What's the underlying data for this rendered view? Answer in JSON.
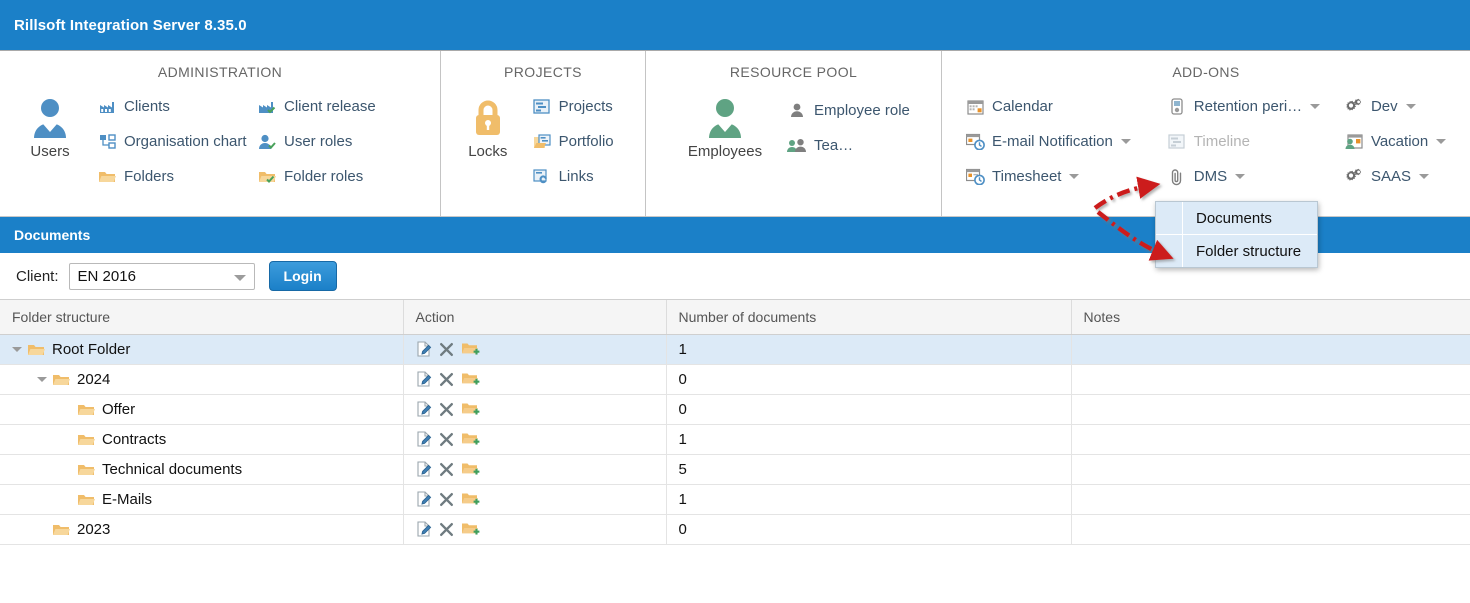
{
  "window": {
    "title": "Rillsoft Integration Server 8.35.0"
  },
  "ribbon": {
    "groups": [
      {
        "title": "ADMINISTRATION",
        "launcher": {
          "label": "Users",
          "icon": "user-icon"
        },
        "col1": [
          {
            "label": "Clients",
            "icon": "factory-icon"
          },
          {
            "label": "Organisation chart",
            "icon": "org-chart-icon"
          },
          {
            "label": "Folders",
            "icon": "folder-icon"
          }
        ],
        "col2": [
          {
            "label": "Client release",
            "icon": "factory-check-icon"
          },
          {
            "label": "User roles",
            "icon": "user-check-icon"
          },
          {
            "label": "Folder roles",
            "icon": "folder-check-icon"
          }
        ]
      },
      {
        "title": "PROJECTS",
        "launcher": {
          "label": "Locks",
          "icon": "lock-icon"
        },
        "col1": [
          {
            "label": "Projects",
            "icon": "project-icon"
          },
          {
            "label": "Portfolio",
            "icon": "portfolio-icon"
          },
          {
            "label": "Links",
            "icon": "links-icon"
          }
        ]
      },
      {
        "title": "RESOURCE POOL",
        "launcher": {
          "label": "Employees",
          "icon": "employee-icon"
        },
        "col1": [
          {
            "label": "Employee role",
            "icon": "person-icon"
          },
          {
            "label": "Tea…",
            "icon": "team-icon"
          }
        ]
      },
      {
        "title": "ADD-ONS",
        "col1": [
          {
            "label": "Calendar",
            "icon": "calendar-icon",
            "caret": false
          },
          {
            "label": "E-mail Notification",
            "icon": "email-clock-icon",
            "caret": true
          },
          {
            "label": "Timesheet",
            "icon": "timesheet-clock-icon",
            "caret": true
          }
        ],
        "col2": [
          {
            "label": "Retention peri…",
            "icon": "retention-icon",
            "caret": true
          },
          {
            "label": "Timeline",
            "icon": "timeline-icon",
            "caret": false,
            "disabled": true
          },
          {
            "label": "DMS",
            "icon": "paperclip-icon",
            "caret": true
          }
        ],
        "col3": [
          {
            "label": "Dev",
            "icon": "gears-icon",
            "caret": true
          },
          {
            "label": "Vacation",
            "icon": "vacation-icon",
            "caret": true
          },
          {
            "label": "SAAS",
            "icon": "gears-icon",
            "caret": true
          }
        ]
      }
    ]
  },
  "dms_menu": {
    "items": [
      {
        "label": "Documents"
      },
      {
        "label": "Folder structure"
      }
    ]
  },
  "page": {
    "header": "Documents",
    "client_label": "Client:",
    "client_value": "EN 2016",
    "login_label": "Login"
  },
  "table": {
    "columns": [
      "Folder structure",
      "Action",
      "Number of documents",
      "Notes"
    ],
    "rows": [
      {
        "name": "Root Folder",
        "indent": 0,
        "expandable": true,
        "documents": "1",
        "notes": "",
        "selected": true
      },
      {
        "name": "2024",
        "indent": 1,
        "expandable": true,
        "documents": "0",
        "notes": "",
        "selected": false
      },
      {
        "name": "Offer",
        "indent": 2,
        "expandable": false,
        "documents": "0",
        "notes": "",
        "selected": false
      },
      {
        "name": "Contracts",
        "indent": 2,
        "expandable": false,
        "documents": "1",
        "notes": "",
        "selected": false
      },
      {
        "name": "Technical documents",
        "indent": 2,
        "expandable": false,
        "documents": "5",
        "notes": "",
        "selected": false
      },
      {
        "name": "E-Mails",
        "indent": 2,
        "expandable": false,
        "documents": "1",
        "notes": "",
        "selected": false
      },
      {
        "name": "2023",
        "indent": 1,
        "expandable": false,
        "documents": "0",
        "notes": "",
        "selected": false
      }
    ],
    "action_icons": [
      "edit-icon",
      "delete-icon",
      "add-folder-icon"
    ]
  },
  "colors": {
    "brand_blue": "#1b80c8",
    "selection_blue": "#dceaf7",
    "folder_orange": "#f0bd6a",
    "annotation_red": "#cc1f1f",
    "link_text": "#3c566e"
  }
}
